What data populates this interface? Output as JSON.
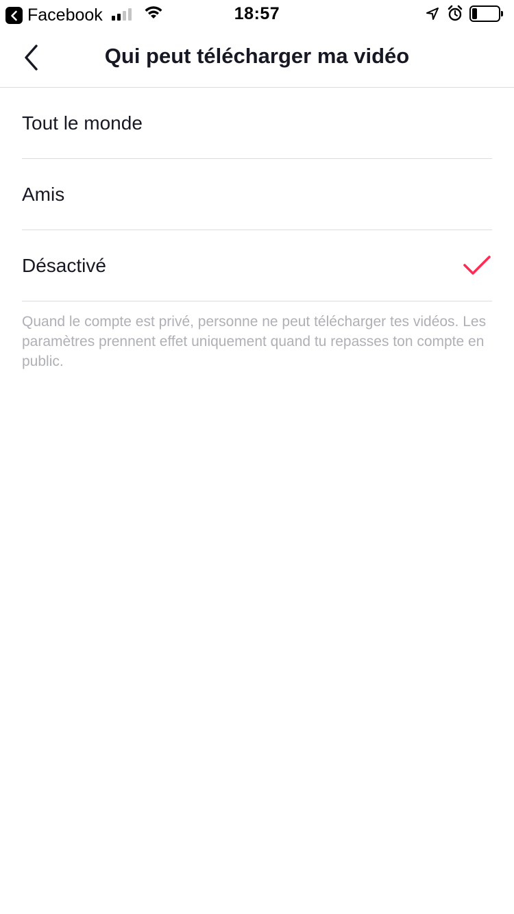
{
  "status_bar": {
    "back_app_label": "Facebook",
    "time": "18:57",
    "battery_percent": 20
  },
  "nav": {
    "title": "Qui peut télécharger ma vidéo"
  },
  "options": [
    {
      "label": "Tout le monde",
      "selected": false
    },
    {
      "label": "Amis",
      "selected": false
    },
    {
      "label": "Désactivé",
      "selected": true
    }
  ],
  "note": "Quand le compte est privé, personne ne peut télécharger tes vidéos. Les paramètres prennent effet uniquement quand tu repasses ton compte en public.",
  "colors": {
    "accent": "#fe2c55",
    "text": "#161823",
    "muted": "#aeb0b5",
    "divider": "#dcdcde"
  },
  "icons": [
    "back-chevron-icon",
    "checkmark-icon",
    "wifi-icon",
    "location-arrow-icon",
    "alarm-clock-icon",
    "battery-icon",
    "cellular-signal-icon"
  ]
}
